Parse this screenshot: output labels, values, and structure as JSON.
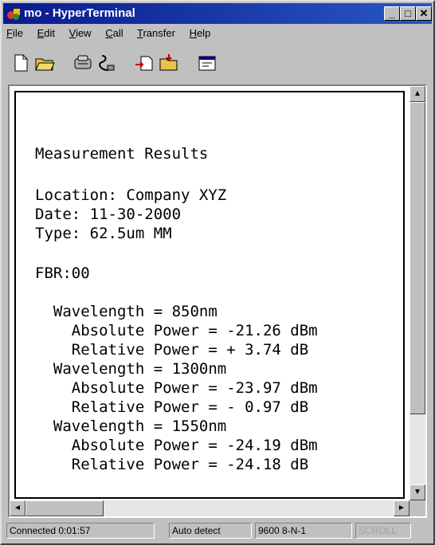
{
  "window": {
    "title": "mo - HyperTerminal",
    "app_icon": "hyperterminal-icon",
    "controls": {
      "minimize": "_",
      "maximize": "□",
      "close": "✕"
    }
  },
  "menu": [
    {
      "label": "File",
      "accel": "F",
      "rest": "ile"
    },
    {
      "label": "Edit",
      "accel": "E",
      "rest": "dit"
    },
    {
      "label": "View",
      "accel": "V",
      "rest": "iew"
    },
    {
      "label": "Call",
      "accel": "C",
      "rest": "all"
    },
    {
      "label": "Transfer",
      "accel": "T",
      "rest": "ransfer"
    },
    {
      "label": "Help",
      "accel": "H",
      "rest": "elp"
    }
  ],
  "toolbar": {
    "icons": [
      "new-icon",
      "open-icon",
      "connect-icon",
      "disconnect-icon",
      "send-icon",
      "receive-icon",
      "properties-icon"
    ]
  },
  "terminal": {
    "lines": [
      "Measurement Results",
      "Location: Company XYZ",
      "Date: 11-30-2000",
      "Type: 62.5um MM",
      "FBR:00",
      "  Wavelength = 850nm",
      "    Absolute Power = -21.26 dBm",
      "    Relative Power = + 3.74 dB",
      "  Wavelength = 1300nm",
      "    Absolute Power = -23.97 dBm",
      "    Relative Power = - 0.97 dB",
      "  Wavelength = 1550nm",
      "    Absolute Power = -24.19 dBm",
      "    Relative Power = -24.18 dB"
    ]
  },
  "statusbar": {
    "connected": "Connected 0:01:57",
    "detect": "Auto detect",
    "settings": "9600 8-N-1",
    "scroll": "SCROLL"
  }
}
